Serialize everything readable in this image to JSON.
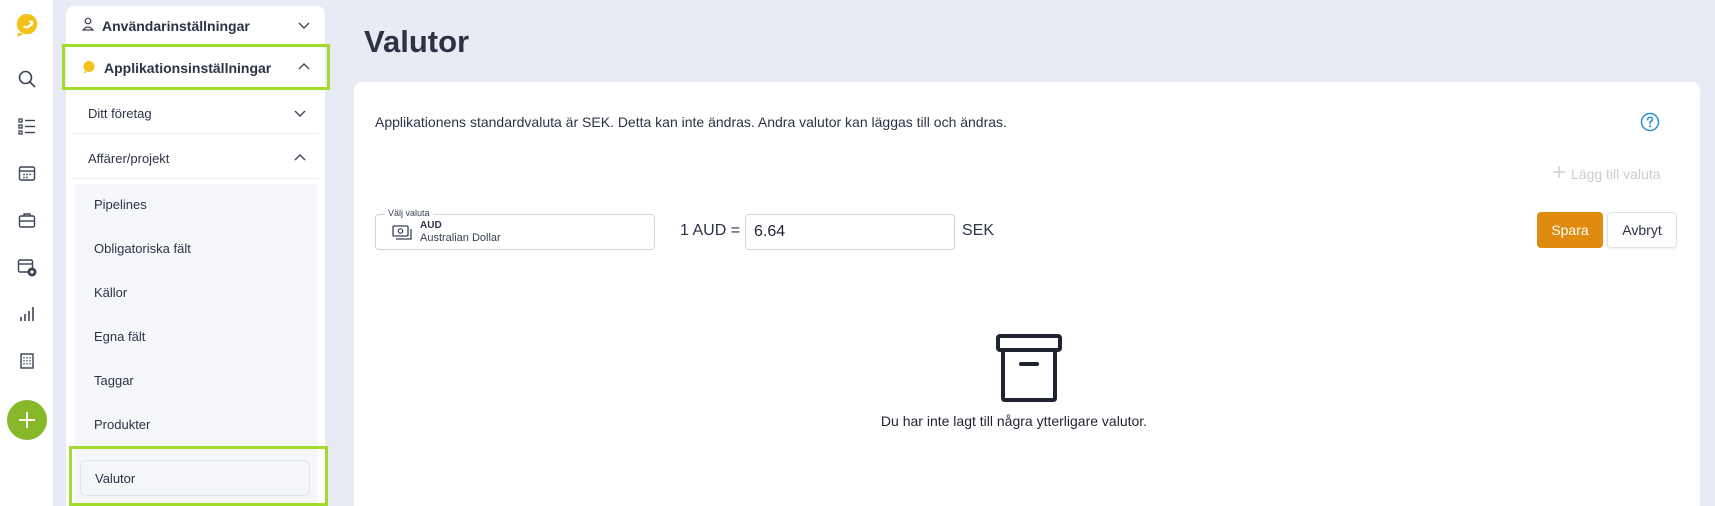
{
  "rail": {
    "icons": [
      "app-logo-icon",
      "search-icon",
      "list-icon",
      "calendar-icon",
      "briefcase-icon",
      "calendar-mail-icon",
      "chart-icon",
      "building-icon",
      "add-icon"
    ],
    "add_color": "#86b82a"
  },
  "sidebar": {
    "user_settings": "Användarinställningar",
    "app_settings": "Applikationsinställningar",
    "groups": [
      {
        "label": "Ditt företag"
      },
      {
        "label": "Affärer/projekt"
      }
    ],
    "items": [
      {
        "label": "Pipelines"
      },
      {
        "label": "Obligatoriska fält"
      },
      {
        "label": "Källor"
      },
      {
        "label": "Egna fält"
      },
      {
        "label": "Taggar"
      },
      {
        "label": "Produkter"
      },
      {
        "label": "Valutor"
      }
    ],
    "highlight_color": "#9fdc2b"
  },
  "main": {
    "title": "Valutor",
    "info": "Applikationens standardvaluta är SEK. Detta kan inte ändras. Andra valutor kan läggas till och ändras.",
    "add_currency": "Lägg till valuta",
    "select": {
      "legend": "Välj valuta",
      "code": "AUD",
      "name": "Australian Dollar"
    },
    "rate_label": "1 AUD =",
    "rate_value": "6.64",
    "rate_unit": "SEK",
    "save": "Spara",
    "cancel": "Avbryt",
    "empty_text": "Du har inte lagt till några ytterligare valutor.",
    "accent_color": "#e08a10"
  }
}
